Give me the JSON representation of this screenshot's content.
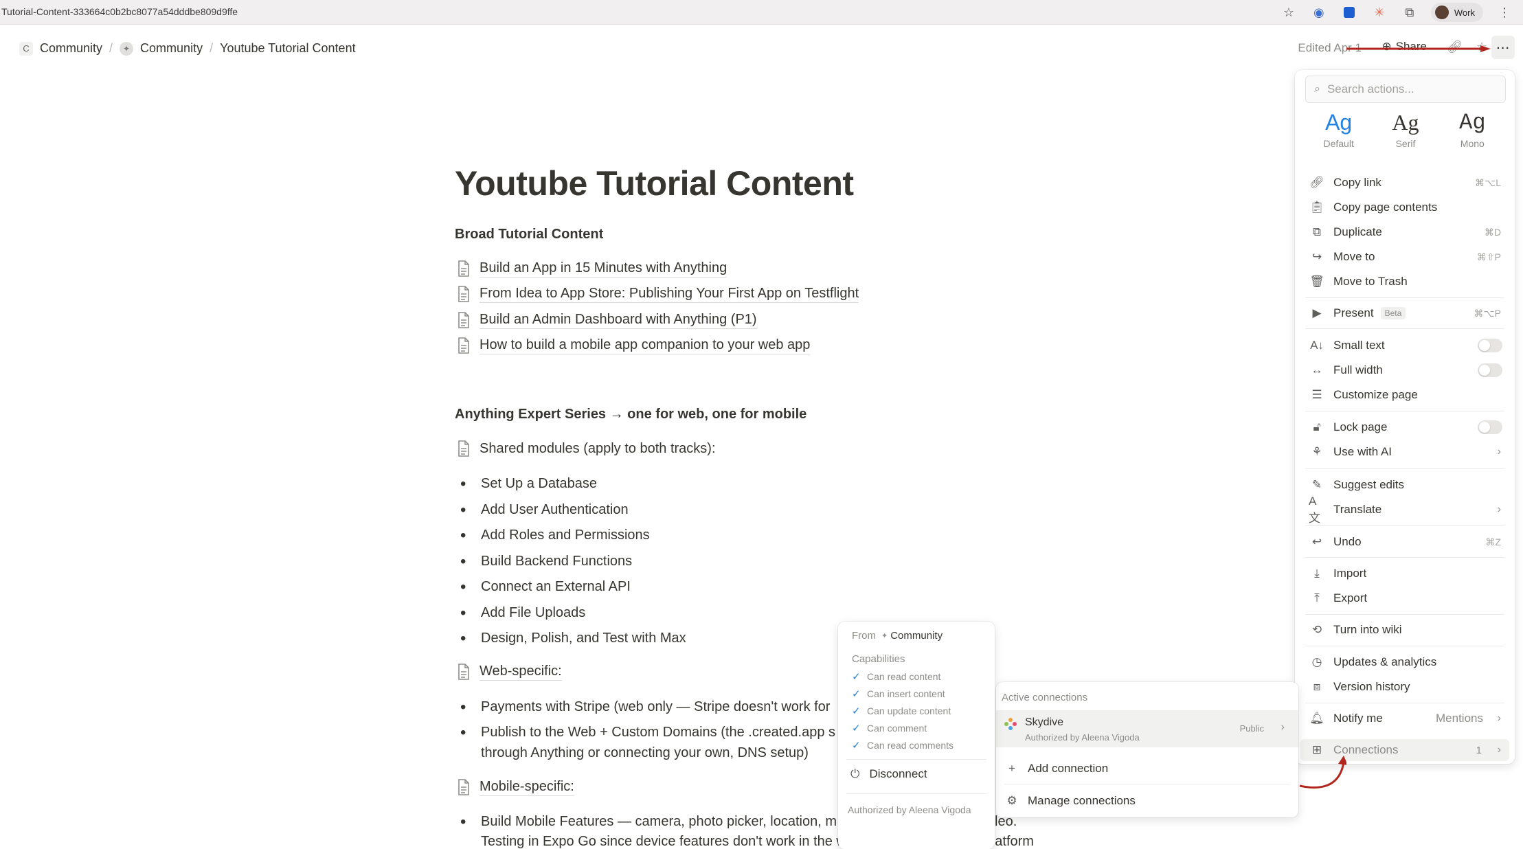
{
  "browser": {
    "url": "Tutorial-Content-333664c0b2bc8077a54dddbe809d9ffe",
    "profile": "Work"
  },
  "breadcrumb": {
    "items": [
      {
        "icon": "C",
        "label": "Community"
      },
      {
        "icon": "compass",
        "label": "Community"
      },
      {
        "label": "Youtube Tutorial Content"
      }
    ]
  },
  "header": {
    "edited": "Edited Apr 1",
    "share_label": "Share"
  },
  "page": {
    "title": "Youtube Tutorial Content",
    "section1_heading": "Broad Tutorial Content",
    "section1_links": [
      "Build an App in 15 Minutes with Anything",
      "From Idea to App Store: Publishing Your First App on Testflight",
      "Build an Admin Dashboard with Anything (P1)",
      "How to build a mobile app companion to your web app"
    ],
    "section2_heading": "Anything Expert Series → one for web, one for mobile",
    "shared_link": "Shared modules (apply to both tracks):",
    "shared_bullets": [
      "Set Up a Database",
      "Add User Authentication",
      "Add Roles and Permissions",
      "Build Backend Functions",
      "Connect an External API",
      "Add File Uploads",
      "Design, Polish, and Test with Max"
    ],
    "web_link": "Web-specific:",
    "web_bullets": [
      "Payments with Stripe (web only — Stripe doesn't work for",
      "Publish to the Web + Custom Domains (the .created.app s"
    ],
    "web_bullet2_cont": "through Anything or connecting your own, DNS setup)",
    "mobile_link": "Mobile-specific:",
    "mobile_bullet1": "Build Mobile Features — camera, photo picker, location, m",
    "mobile_bullet1_tail": "leo.",
    "mobile_bullet1_cont": "Testing in Expo Go since device features don't work in the web preview. The cross-platform"
  },
  "menu": {
    "search_placeholder": "Search actions...",
    "fonts": [
      {
        "glyph": "Ag",
        "label": "Default"
      },
      {
        "glyph": "Ag",
        "label": "Serif"
      },
      {
        "glyph": "Ag",
        "label": "Mono"
      }
    ],
    "items": {
      "copy_link": {
        "label": "Copy link",
        "shortcut": "⌘⌥L"
      },
      "copy_contents": {
        "label": "Copy page contents"
      },
      "duplicate": {
        "label": "Duplicate",
        "shortcut": "⌘D"
      },
      "move_to": {
        "label": "Move to",
        "shortcut": "⌘⇧P"
      },
      "trash": {
        "label": "Move to Trash"
      },
      "present": {
        "label": "Present",
        "badge": "Beta",
        "shortcut": "⌘⌥P"
      },
      "small_text": {
        "label": "Small text"
      },
      "full_width": {
        "label": "Full width"
      },
      "customize": {
        "label": "Customize page"
      },
      "lock": {
        "label": "Lock page"
      },
      "use_ai": {
        "label": "Use with AI"
      },
      "suggest": {
        "label": "Suggest edits"
      },
      "translate": {
        "label": "Translate"
      },
      "undo": {
        "label": "Undo",
        "shortcut": "⌘Z"
      },
      "import": {
        "label": "Import"
      },
      "export": {
        "label": "Export"
      },
      "wiki": {
        "label": "Turn into wiki"
      },
      "updates": {
        "label": "Updates & analytics"
      },
      "version": {
        "label": "Version history"
      },
      "notify": {
        "label": "Notify me",
        "value": "Mentions"
      },
      "connections": {
        "label": "Connections",
        "count": "1"
      }
    }
  },
  "connections": {
    "header": "Active connections",
    "active": {
      "name": "Skydive",
      "authorized": "Authorized by Aleena Vigoda",
      "visibility": "Public"
    },
    "add_label": "Add connection",
    "manage_label": "Manage connections"
  },
  "details": {
    "from_label": "From",
    "workspace": "Community",
    "capabilities_label": "Capabilities",
    "capabilities": [
      "Can read content",
      "Can insert content",
      "Can update content",
      "Can comment",
      "Can read comments"
    ],
    "disconnect_label": "Disconnect",
    "authorized": "Authorized by Aleena Vigoda"
  },
  "colors": {
    "accent": "#2383e2",
    "annotation_red": "#b3261e",
    "text": "#37352f",
    "muted": "#8e8d89"
  }
}
